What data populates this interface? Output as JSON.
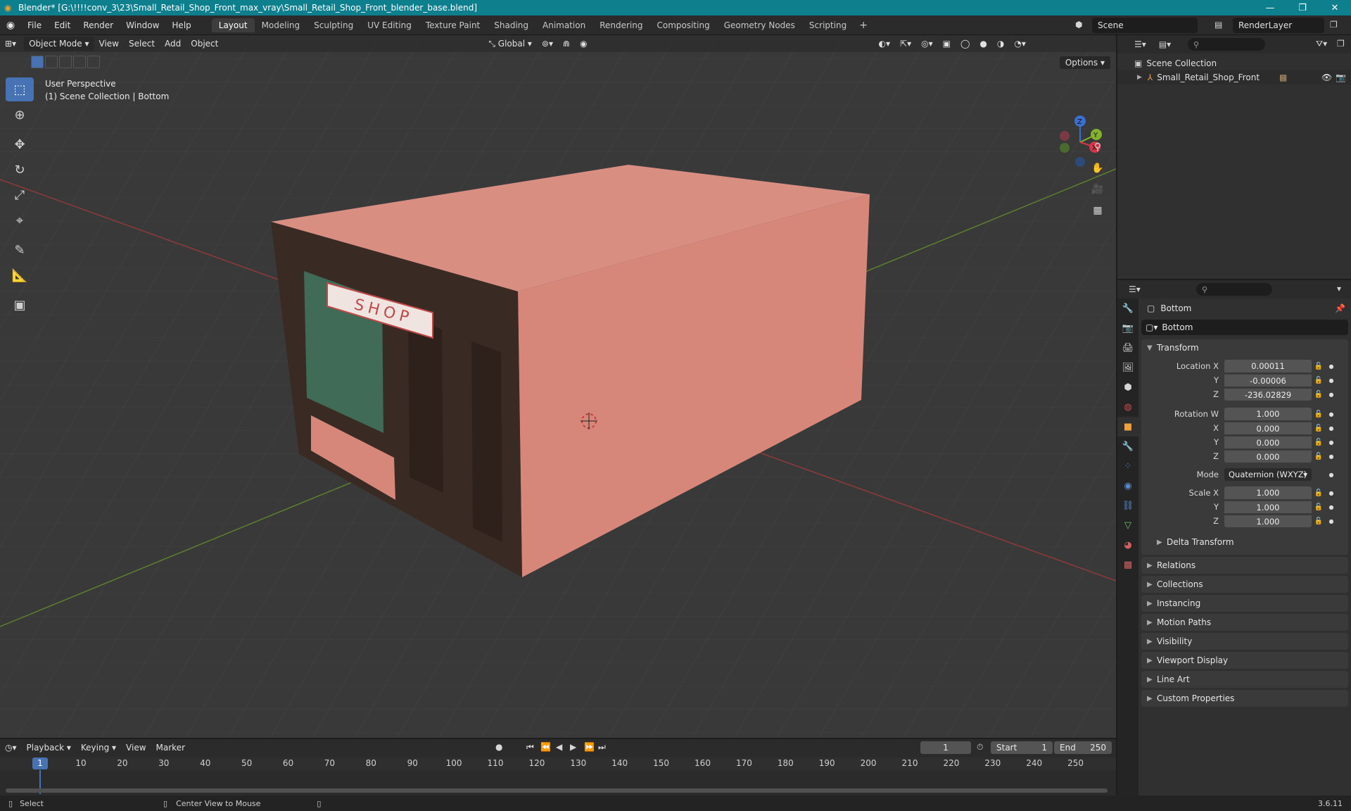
{
  "window": {
    "title": "Blender* [G:\\!!!!conv_3\\23\\Small_Retail_Shop_Front_max_vray\\Small_Retail_Shop_Front_blender_base.blend]",
    "minimize": "—",
    "maximize": "❐",
    "close": "✕"
  },
  "menu": [
    "File",
    "Edit",
    "Render",
    "Window",
    "Help"
  ],
  "workspaces": [
    "Layout",
    "Modeling",
    "Sculpting",
    "UV Editing",
    "Texture Paint",
    "Shading",
    "Animation",
    "Rendering",
    "Compositing",
    "Geometry Nodes",
    "Scripting"
  ],
  "workspace_add": "+",
  "scene": {
    "name": "Scene",
    "render_layer": "RenderLayer"
  },
  "viewport": {
    "mode": "Object Mode",
    "menus": [
      "View",
      "Select",
      "Add",
      "Object"
    ],
    "orientation": "Global",
    "options": "Options",
    "perspective": "User Perspective",
    "collection_info": "(1) Scene Collection | Bottom",
    "sign_text": "SHOP",
    "gizmo": {
      "z": "Z",
      "y": "Y",
      "x": "X"
    }
  },
  "outliner": {
    "search_placeholder": "",
    "root": "Scene Collection",
    "items": [
      {
        "name": "Small_Retail_Shop_Front"
      }
    ]
  },
  "properties": {
    "object_name": "Bottom",
    "data_name": "Bottom",
    "transform_header": "Transform",
    "location": {
      "label": "Location X",
      "x": "0.00011",
      "y": "-0.00006",
      "z": "-236.02829"
    },
    "rotation": {
      "label": "Rotation W",
      "w": "1.000",
      "x": "0.000",
      "y": "0.000",
      "z": "0.000"
    },
    "mode_label": "Mode",
    "mode_value": "Quaternion (WXYZ)",
    "scale": {
      "label": "Scale X",
      "x": "1.000",
      "y": "1.000",
      "z": "1.000"
    },
    "axis_labels": {
      "y": "Y",
      "z": "Z",
      "x": "X"
    },
    "delta": "Delta Transform",
    "panels": [
      "Relations",
      "Collections",
      "Instancing",
      "Motion Paths",
      "Visibility",
      "Viewport Display",
      "Line Art",
      "Custom Properties"
    ]
  },
  "timeline": {
    "menus": [
      "Playback",
      "Keying",
      "View",
      "Marker"
    ],
    "current_frame": "1",
    "start_label": "Start",
    "start": "1",
    "end_label": "End",
    "end": "250",
    "ticks": [
      "10",
      "20",
      "30",
      "40",
      "50",
      "60",
      "70",
      "80",
      "90",
      "100",
      "110",
      "120",
      "130",
      "140",
      "150",
      "160",
      "170",
      "180",
      "190",
      "200",
      "210",
      "220",
      "230",
      "240",
      "250"
    ]
  },
  "status": {
    "select": "Select",
    "center": "Center View to Mouse",
    "version": "3.6.11"
  },
  "colors": {
    "accent": "#4772b3",
    "titlebar": "#0e7f8d",
    "wall": "#d9877a"
  }
}
